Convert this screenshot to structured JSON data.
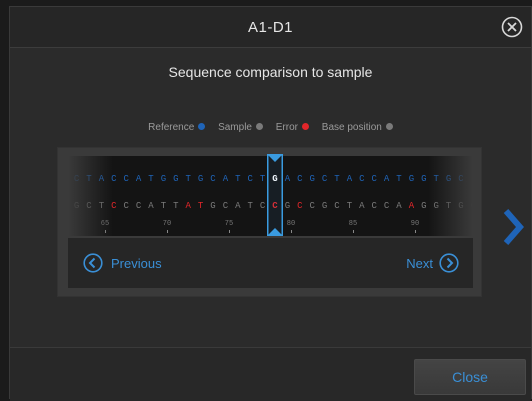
{
  "dialog": {
    "title": "A1-D1",
    "subtitle": "Sequence comparison to sample",
    "close_icon": "close-circle-icon"
  },
  "legend": [
    {
      "label": "Reference",
      "color": "#1f64b8"
    },
    {
      "label": "Sample",
      "color": "#7a7a7a"
    },
    {
      "label": "Error",
      "color": "#e2262a"
    },
    {
      "label": "Base position",
      "color": "#7a7a7a"
    }
  ],
  "sequence": {
    "reference": "GCTACCATGGTGCATCTGACGCTACCATGGTGC",
    "sample": "CGCTCCCATTATGCATCCGCCGCTACCAAGGTGC",
    "sample_error_indices": [
      4,
      10,
      11,
      17,
      19,
      28
    ],
    "selected_base": "T",
    "selected_index": 17,
    "positions": [
      "65",
      "70",
      "75",
      "80",
      "85",
      "90"
    ],
    "colors": {
      "reference": "#1f64b8",
      "sample": "#7a7a7a",
      "error": "#e2262a",
      "selected": "#ffffff",
      "cursor": "#3a9be0"
    }
  },
  "navigation": {
    "previous_label": "Previous",
    "next_label": "Next",
    "previous_icon": "chevron-left-circle-icon",
    "next_icon": "chevron-right-circle-icon",
    "side_icon": "chevron-right-icon"
  },
  "footer": {
    "close_label": "Close"
  }
}
